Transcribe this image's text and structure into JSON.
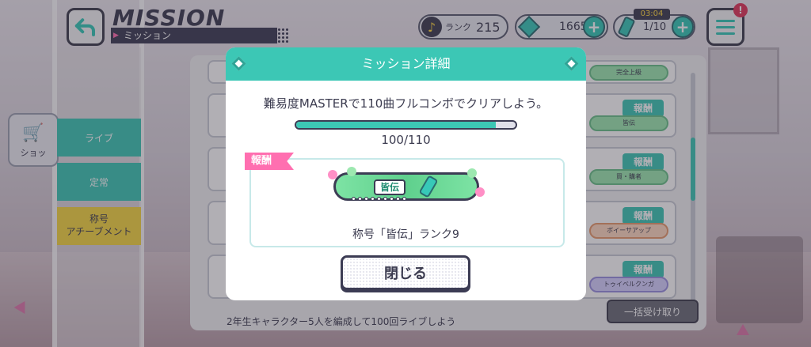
{
  "header": {
    "title": "MISSION",
    "subtitle": "ミッション",
    "rank_label": "ランク",
    "rank_value": "215",
    "gems": "1665",
    "energy": "1/10",
    "timer": "03:04",
    "alert": "!"
  },
  "sidebar": {
    "shop": "ショッ",
    "tabs": [
      {
        "label": "ライブ"
      },
      {
        "label": "定常"
      },
      {
        "label": "称号\nアチーブメント"
      }
    ]
  },
  "list": {
    "reward_tag": "報酬",
    "chips": [
      "完全上級",
      "皆伝",
      "買・購者",
      "ボイーサアップ",
      "トゥイベルクンガ"
    ],
    "bottom_text": "2年生キャラクター5人を編成して100回ライブしよう",
    "collect_all": "一括受け取り"
  },
  "modal": {
    "title": "ミッション詳細",
    "mission_text": "難易度MASTERで110曲フルコンボでクリアしよう。",
    "progress_current": 100,
    "progress_total": 110,
    "progress_text": "100/110",
    "reward_label": "報酬",
    "badge_text": "皆伝",
    "reward_name": "称号「皆伝」ランク9",
    "close_label": "閉じる"
  },
  "colors": {
    "accent": "#3cc7b5",
    "pink": "#ff6fb0",
    "dark": "#3c3c54",
    "yellow": "#f6d742"
  },
  "icons": [
    "back-arrow-icon",
    "music-note-icon",
    "gem-icon",
    "plus-icon",
    "energy-can-icon",
    "menu-icon",
    "cart-icon",
    "diamond-icon"
  ]
}
